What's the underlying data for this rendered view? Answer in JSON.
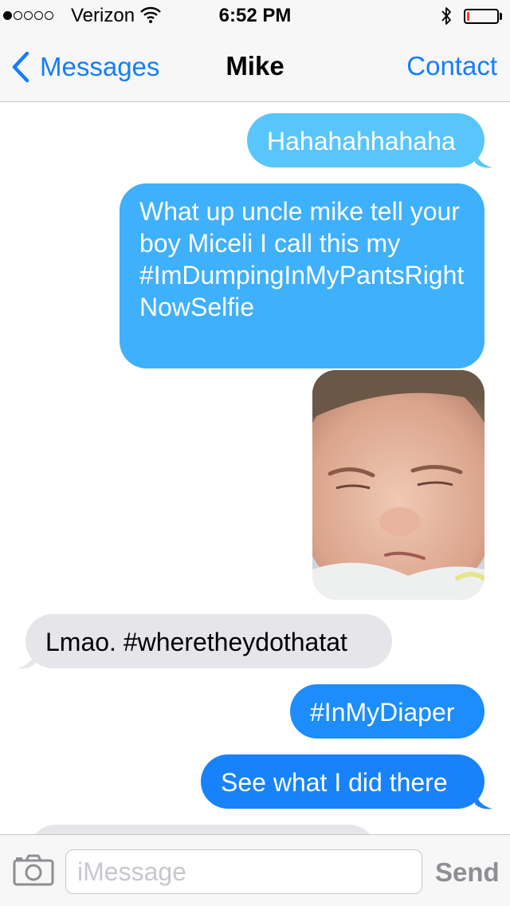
{
  "status": {
    "carrier": "Verizon",
    "time": "6:52 PM",
    "signal_bars_filled": 1,
    "signal_bars_total": 5,
    "battery_level": 0.05
  },
  "nav": {
    "back_label": "Messages",
    "title": "Mike",
    "right_label": "Contact"
  },
  "messages": [
    {
      "from": "me",
      "text": "Hahahahhahaha"
    },
    {
      "from": "me",
      "text": "What up uncle mike tell your boy Miceli I call this my #ImDumpingInMyPantsRightNowSelfie"
    },
    {
      "from": "me",
      "type": "photo"
    },
    {
      "from": "them",
      "text": "Lmao. #wheretheydothatat"
    },
    {
      "from": "me",
      "text": "#InMyDiaper"
    },
    {
      "from": "me",
      "text": "See what I did there"
    }
  ],
  "colors": {
    "accent": "#147efb",
    "bubble_out_light": "#56c4fb",
    "bubble_out_dark": "#1882fb",
    "bubble_in": "#e5e5ea"
  },
  "input": {
    "placeholder": "iMessage",
    "value": "",
    "send_label": "Send"
  },
  "icons": {
    "back": "chevron-left-icon",
    "camera": "camera-icon",
    "wifi": "wifi-icon",
    "bluetooth": "bluetooth-icon",
    "battery": "battery-icon"
  }
}
